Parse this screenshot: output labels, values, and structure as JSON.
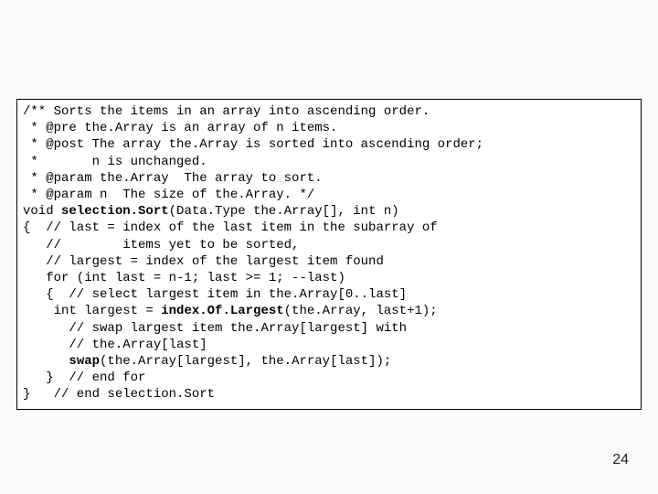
{
  "code": {
    "l01a": "/** Sorts the items in an array into ascending order.",
    "l02a": " * @pre the.Array is an array of n items.",
    "l03a": " * @post The array the.Array is sorted into ascending order;",
    "l04a": " *       n is unchanged.",
    "l05a": " * @param the.Array  The array to sort.",
    "l06a": " * @param n  The size of the.Array. */",
    "l07a": "void ",
    "l07b": "selection.Sort",
    "l07c": "(Data.Type the.Array[], int n)",
    "l08a": "{  // last = index of the last item in the subarray of",
    "l09a": "   //        items yet to be sorted,",
    "l10a": "   // largest = index of the largest item found",
    "l11a": "   for (int last = n-1; last >= 1; --last)",
    "l12a": "   {  // select largest item in the.Array[0..last]",
    "l13a": "    int largest = ",
    "l13b": "index.Of.Largest",
    "l13c": "(the.Array, last+1);",
    "l14a": "",
    "l15a": "      // swap largest item the.Array[largest] with",
    "l16a": "      // the.Array[last]",
    "l17a": "      ",
    "l17b": "swap",
    "l17c": "(the.Array[largest], the.Array[last]);",
    "l18a": "   }  // end for",
    "l19a": "}   // end selection.Sort"
  },
  "page_number": "24"
}
